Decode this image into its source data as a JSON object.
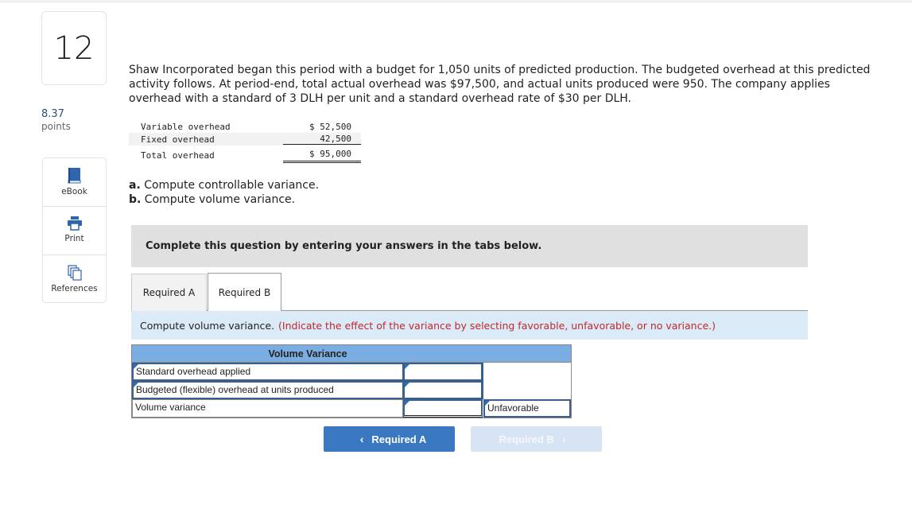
{
  "question": {
    "number": "12",
    "points_value": "8.37",
    "points_label": "points"
  },
  "tools": [
    {
      "label": "eBook",
      "icon": "book-icon"
    },
    {
      "label": "Print",
      "icon": "printer-icon"
    },
    {
      "label": "References",
      "icon": "documents-icon"
    }
  ],
  "problem_text": "Shaw Incorporated began this period with a budget for 1,050 units of predicted production. The budgeted overhead at this predicted activity follows. At period-end, total actual overhead was $97,500, and actual units produced were 950. The company applies overhead with a standard of 3 DLH per unit and a standard overhead rate of $30 per DLH.",
  "budget": {
    "rows": [
      {
        "label": "Variable overhead",
        "value": "$ 52,500"
      },
      {
        "label": "Fixed overhead",
        "value": "42,500"
      },
      {
        "label": "Total overhead",
        "value": "$ 95,000"
      }
    ]
  },
  "requirements": [
    {
      "letter": "a.",
      "text": " Compute controllable variance."
    },
    {
      "letter": "b.",
      "text": " Compute volume variance."
    }
  ],
  "instruction": "Complete this question by entering your answers in the tabs below.",
  "tabs": [
    {
      "label": "Required A",
      "active": false
    },
    {
      "label": "Required B",
      "active": true
    }
  ],
  "prompt": {
    "text": "Compute volume variance.",
    "note": "(Indicate the effect of the variance by selecting favorable, unfavorable, or no variance.)"
  },
  "volume_table": {
    "title": "Volume Variance",
    "rows": [
      {
        "label": "Standard overhead applied",
        "value": "",
        "effect": ""
      },
      {
        "label": "Budgeted (flexible) overhead at units produced",
        "value": "",
        "effect": ""
      },
      {
        "label": "Volume variance",
        "value": "",
        "effect": "Unfavorable"
      }
    ]
  },
  "nav": {
    "prev_label": "Required A",
    "next_label": "Required B",
    "prev_chevron": "‹",
    "next_chevron": "›"
  },
  "colors": {
    "accent": "#3a78c2",
    "table_header": "#7aaee3",
    "prompt_bg": "#dbeaf7",
    "note_red": "#c0282d"
  }
}
